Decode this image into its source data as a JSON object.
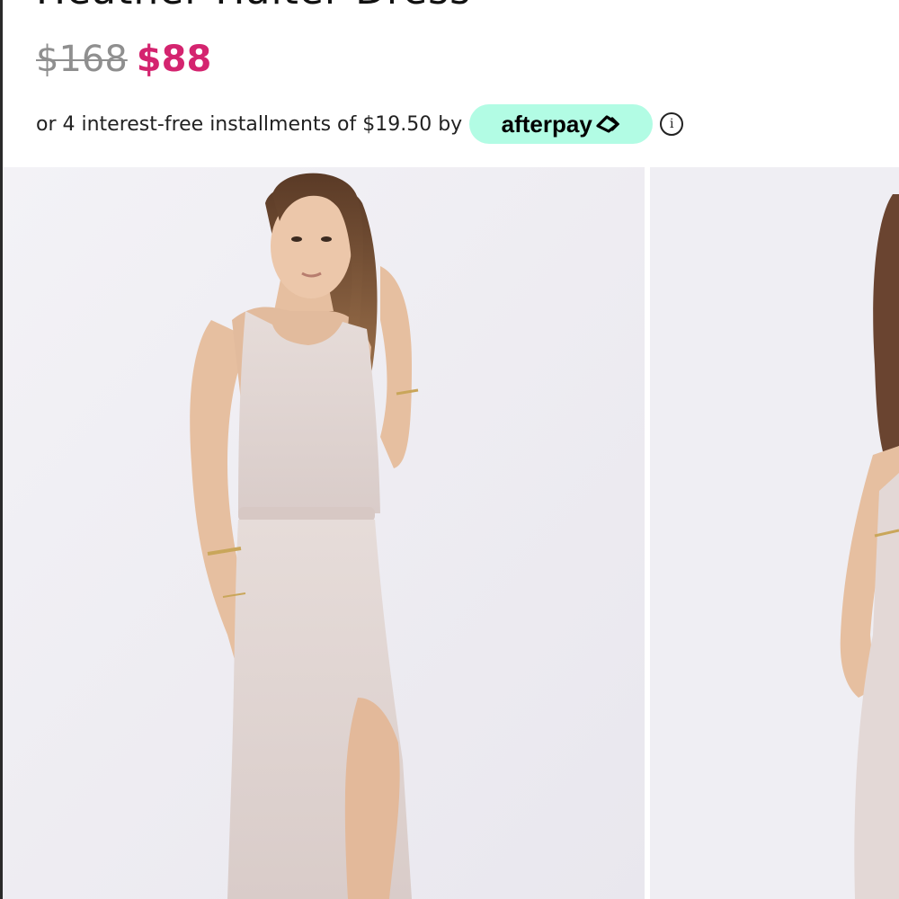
{
  "product": {
    "title": "Heather Halter Dress",
    "original_price": "$168",
    "sale_price": "$88"
  },
  "afterpay": {
    "text": "or 4 interest-free installments of $19.50 by",
    "brand_label": "afterpay",
    "info_symbol": "i",
    "badge_color": "#b2fce4"
  },
  "colors": {
    "sale": "#d4246f",
    "strikethrough": "#8f8f8f",
    "background": "#efeef3"
  },
  "gallery": {
    "images": [
      {
        "description_name": "model-front-photo"
      },
      {
        "description_name": "model-side-photo"
      }
    ]
  }
}
